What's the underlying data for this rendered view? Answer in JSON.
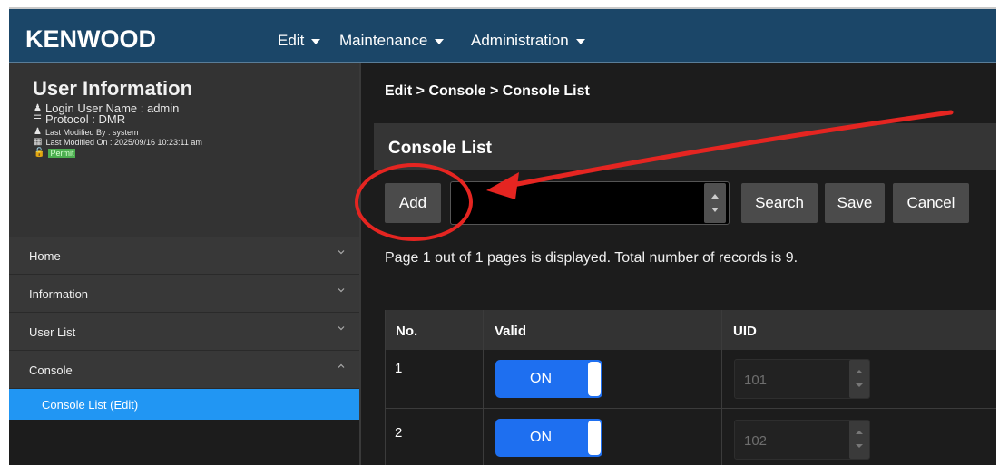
{
  "header": {
    "logo": "KENWOOD",
    "menus": [
      {
        "label": "Edit"
      },
      {
        "label": "Maintenance"
      },
      {
        "label": "Administration"
      }
    ]
  },
  "user_info": {
    "title": "User Information",
    "login_user": "Login User Name : admin",
    "protocol": "Protocol : DMR",
    "last_modified_by": "Last Modified By : system",
    "last_modified_on": "Last Modified On : 2025/09/16 10:23:11 am",
    "permission": "Permit"
  },
  "sidebar": {
    "items": [
      {
        "label": "Home",
        "expanded": false
      },
      {
        "label": "Information",
        "expanded": false
      },
      {
        "label": "User List",
        "expanded": false
      },
      {
        "label": "Console",
        "expanded": true
      }
    ],
    "sub_items": [
      {
        "label": "Console List (Edit)",
        "active": true
      }
    ]
  },
  "breadcrumb": "Edit  > Console > Console List",
  "section_title": "Console List",
  "toolbar": {
    "add_label": "Add",
    "search_label": "Search",
    "save_label": "Save",
    "cancel_label": "Cancel",
    "spin_value": ""
  },
  "page_info": "Page 1 out of 1 pages is displayed. Total number of records is 9.",
  "table": {
    "headers": [
      "No.",
      "Valid",
      "UID"
    ],
    "rows": [
      {
        "no": "1",
        "valid": "ON",
        "uid": "101"
      },
      {
        "no": "2",
        "valid": "ON",
        "uid": "102"
      }
    ]
  },
  "colors": {
    "header_bg": "#1b4668",
    "active_nav": "#2196f3",
    "toggle_on": "#1e6ff0",
    "annotation": "#e52521"
  }
}
